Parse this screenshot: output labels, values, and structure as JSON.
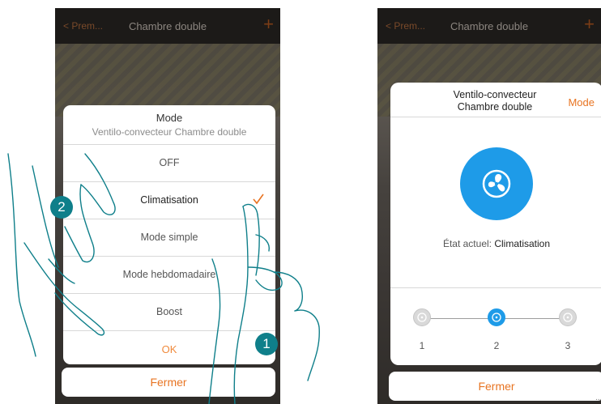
{
  "left_screen": {
    "topbar": {
      "back_label": "Prem...",
      "title": "Chambre double",
      "add_icon": "+"
    },
    "mode_dialog": {
      "title": "Mode",
      "subtitle": "Ventilo-convecteur Chambre double",
      "options": [
        "OFF",
        "Climatisation",
        "Mode simple",
        "Mode hebdomadaire",
        "Boost"
      ],
      "selected": "Climatisation",
      "ok_label": "OK"
    },
    "close_label": "Fermer"
  },
  "right_screen": {
    "topbar": {
      "back_label": "Prem...",
      "title": "Chambre double",
      "add_icon": "+"
    },
    "device_card": {
      "title_line1": "Ventilo-convecteur",
      "title_line2": "Chambre double",
      "mode_label": "Mode",
      "status_prefix": "État actuel:",
      "status_value": "Climatisation",
      "speeds": [
        "1",
        "2",
        "3"
      ],
      "active_speed": "2"
    },
    "close_label": "Fermer"
  },
  "callouts": {
    "step1": "1",
    "step2": "2"
  },
  "corner_mark": "...",
  "colors": {
    "accent": "#e87422",
    "fan_blue": "#1e9be8",
    "badge": "#0f7f8a"
  }
}
